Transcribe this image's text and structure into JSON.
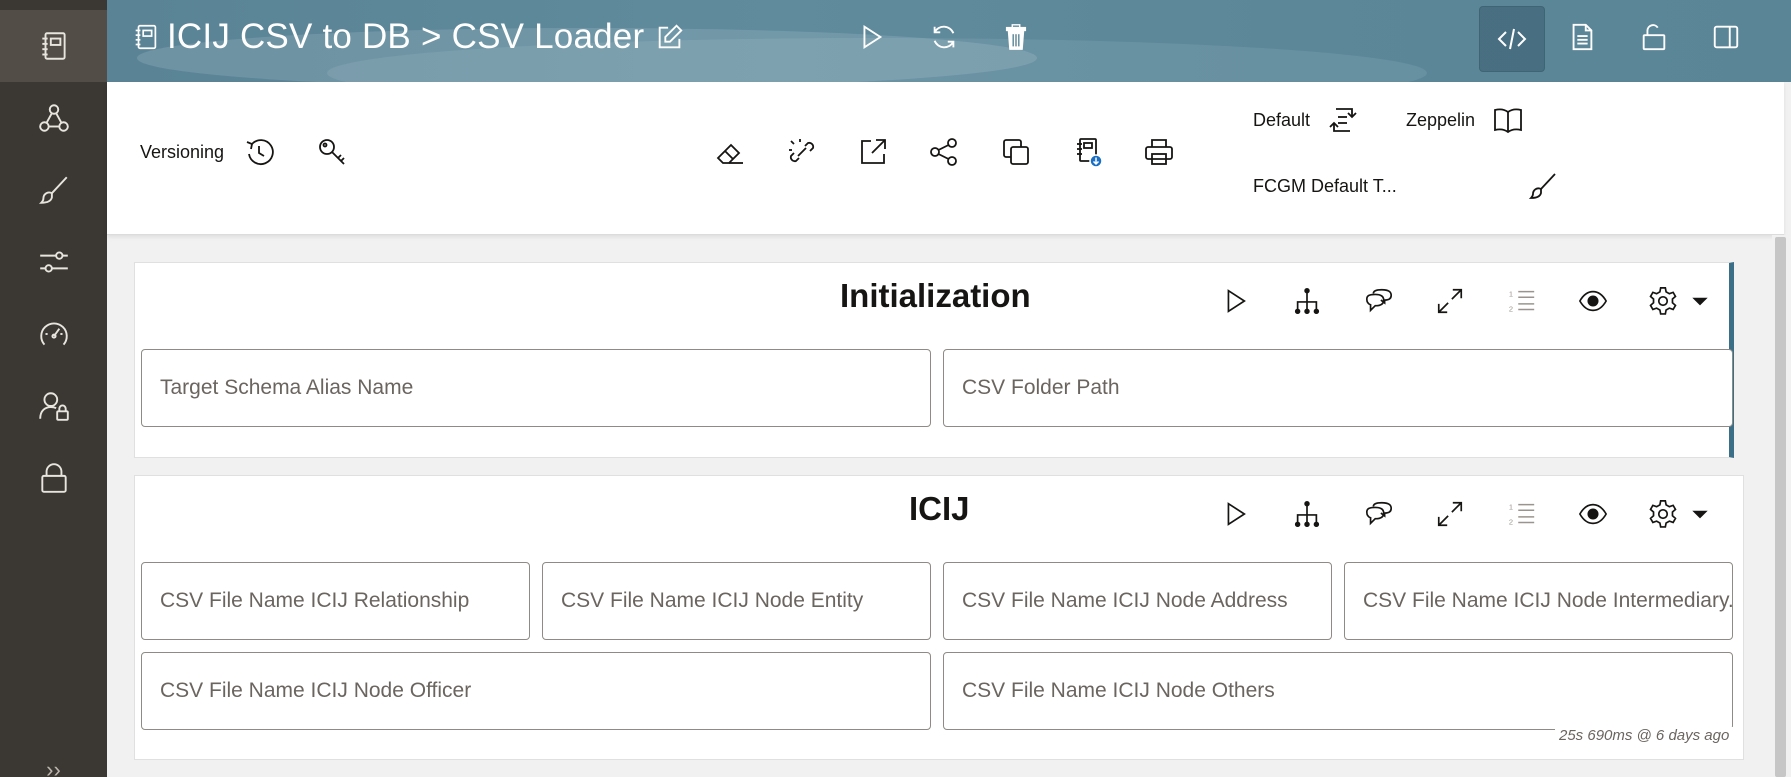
{
  "header": {
    "notebook": "ICIJ CSV to DB",
    "separator": ">",
    "page": "CSV Loader"
  },
  "toolbar": {
    "versioning_label": "Versioning",
    "interpreter_label": "Default",
    "mode_label": "Zeppelin",
    "template_label": "FCGM Default T..."
  },
  "paragraphs": [
    {
      "title": "Initialization",
      "fields": [
        {
          "placeholder": "Target Schema Alias Name"
        },
        {
          "placeholder": "CSV Folder Path"
        }
      ]
    },
    {
      "title": "ICIJ",
      "fields": [
        {
          "placeholder": "CSV File Name ICIJ Relationship"
        },
        {
          "placeholder": "CSV File Name ICIJ Node Entity"
        },
        {
          "placeholder": "CSV File Name ICIJ Node Address"
        },
        {
          "placeholder": "CSV File Name ICIJ Node Intermediary."
        },
        {
          "placeholder": "CSV File Name ICIJ Node Officer"
        },
        {
          "placeholder": "CSV File Name ICIJ Node Others"
        }
      ],
      "status": "25s 690ms @ 6 days ago"
    }
  ],
  "rail": {
    "more": "››"
  },
  "icons": {
    "rail": [
      "notebook-icon",
      "graph-icon",
      "brush-icon",
      "sliders-icon",
      "dashboard-icon",
      "user-lock-icon",
      "lock-icon"
    ],
    "header": [
      "edit-icon",
      "run-icon",
      "refresh-icon",
      "trash-icon",
      "code-icon",
      "document-icon",
      "unlock-icon",
      "split-panel-icon"
    ],
    "toolbar": [
      "history-icon",
      "key-icon",
      "eraser-icon",
      "unlink-icon",
      "export-icon",
      "share-icon",
      "copy-icon",
      "notebook-download-icon",
      "print-icon",
      "switch-icon",
      "book-icon",
      "brush-icon"
    ],
    "paragraph": [
      "run-icon",
      "hierarchy-icon",
      "comments-icon",
      "expand-icon",
      "numbered-list-icon",
      "eye-icon",
      "gear-icon",
      "caret-down-icon"
    ]
  },
  "colors": {
    "rail": "#3b3733",
    "rail_active": "#524d47",
    "header": "#5a8496",
    "active_border": "#3a6f87",
    "badge_blue": "#1a6fc4"
  }
}
